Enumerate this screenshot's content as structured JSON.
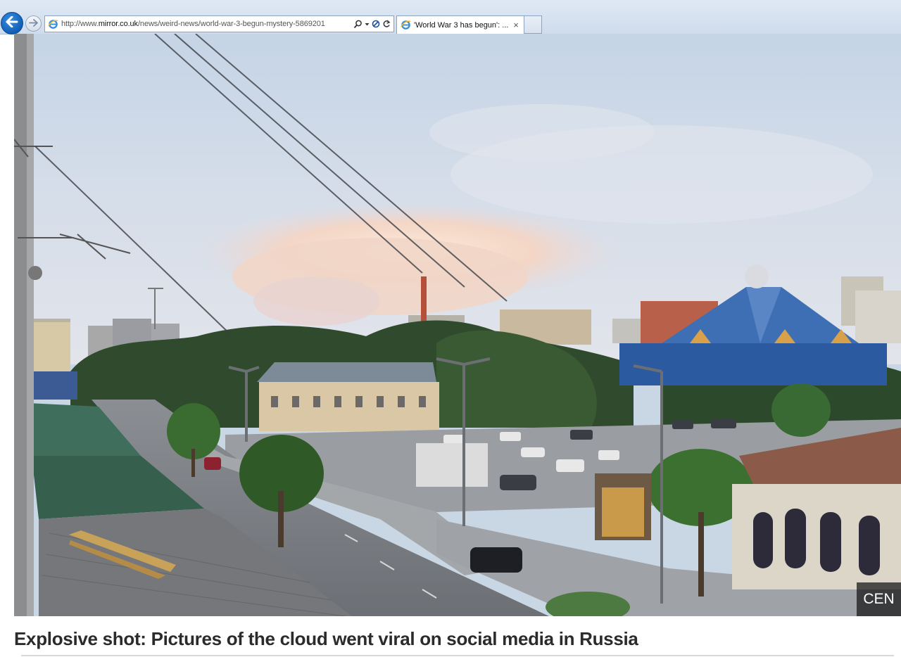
{
  "browser": {
    "address_url_prefix": "http://www.",
    "address_url_host": "mirror.co.uk",
    "address_url_path": "/news/weird-news/world-war-3-begun-mystery-5869201",
    "tab_title": "'World War 3 has begun': ...",
    "tab_close": "×"
  },
  "article": {
    "photo_credit": "CEN",
    "caption": "Explosive shot: Pictures of the cloud went viral on social media in Russia"
  },
  "icons": {
    "back": "back-arrow-icon",
    "forward": "forward-arrow-icon",
    "site": "ie-page-icon",
    "search": "search-icon",
    "refresh": "refresh-icon",
    "stop": "stop-icon"
  },
  "colors": {
    "back_button": "#1565c0",
    "chrome": "#d6e2f0",
    "caption_text": "#2b2b2b",
    "sky": "#c9d6e4",
    "cloud": "#f6d8c6",
    "circus_roof": "#3e6fb5"
  }
}
